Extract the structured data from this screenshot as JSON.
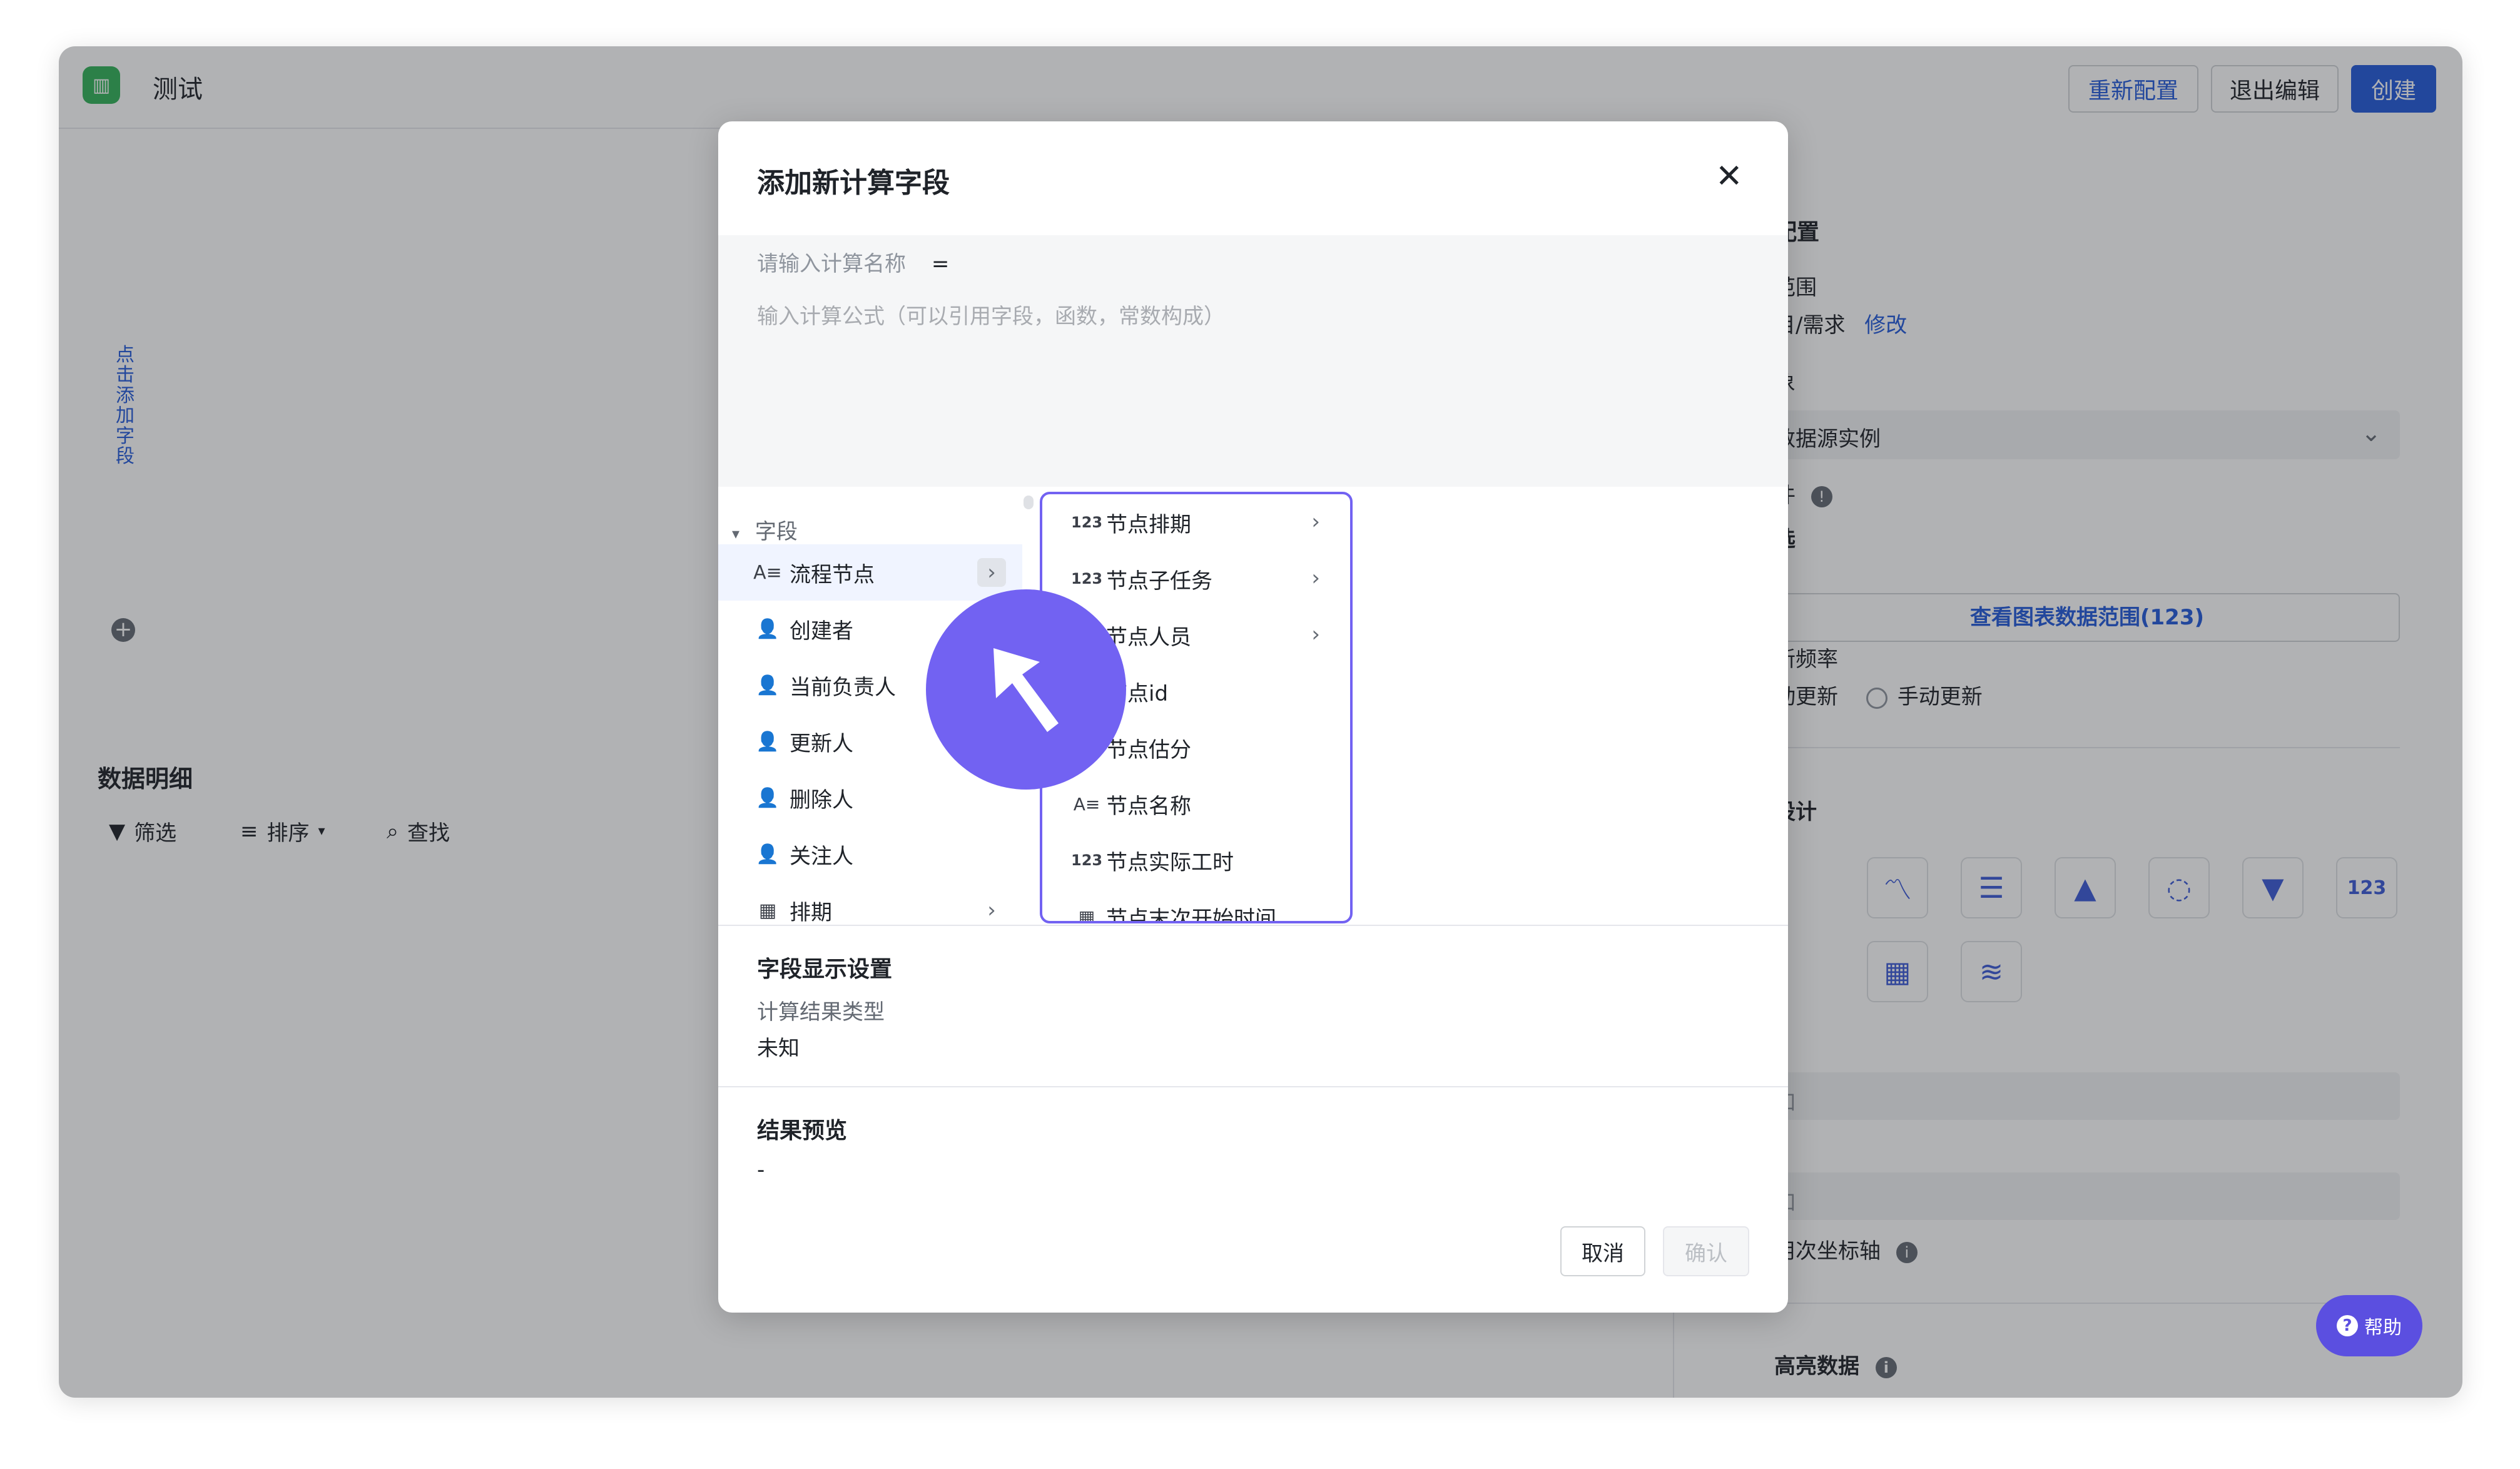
{
  "app": {
    "title": "测试",
    "icon": "bar-chart-icon"
  },
  "header": {
    "reconfigure": "重新配置",
    "exit_edit": "退出编辑",
    "create": "创建"
  },
  "left": {
    "vertical_text": "点击添加字段",
    "detail_title": "数据明细",
    "toolbar": {
      "filter": "筛选",
      "sort": "排序",
      "find": "查找"
    }
  },
  "right": {
    "config_title": "配置",
    "range_label": "范围",
    "range_value": "目/需求",
    "range_edit": "修改",
    "object_label": "象",
    "object_value": "数据源实例",
    "condition_label": "件",
    "condition_value": "选",
    "view_range_btn": "查看图表数据范围(123)",
    "refresh_label": "新频率",
    "refresh_auto": "动更新",
    "refresh_manual": "手动更新",
    "design_label": "设计",
    "input1_ph": "加",
    "input2_ph": "加",
    "secondary_axis": "用次坐标轴",
    "highlight": "高亮数据"
  },
  "help": {
    "label": "帮助"
  },
  "modal": {
    "title": "添加新计算字段",
    "name_placeholder": "请输入计算名称",
    "equals": "=",
    "formula_placeholder": "输入计算公式（可以引用字段，函数，常数构成）",
    "field_header": "字段",
    "fields": [
      {
        "label": "流程节点",
        "icon": "text-field-icon"
      },
      {
        "label": "创建者",
        "icon": "person-icon"
      },
      {
        "label": "当前负责人",
        "icon": "person-icon"
      },
      {
        "label": "更新人",
        "icon": "person-icon"
      },
      {
        "label": "删除人",
        "icon": "person-icon"
      },
      {
        "label": "关注人",
        "icon": "person-icon"
      },
      {
        "label": "排期",
        "icon": "calendar-icon"
      }
    ],
    "sub_fields": [
      {
        "label": "节点排期",
        "icon": "number-icon"
      },
      {
        "label": "节点子任务",
        "icon": "number-icon"
      },
      {
        "label": "节点人员",
        "icon": "number-icon"
      },
      {
        "label": "节点id",
        "icon": "number-icon"
      },
      {
        "label": "节点估分",
        "icon": "number-icon"
      },
      {
        "label": "节点名称",
        "icon": "text-field-icon"
      },
      {
        "label": "节点实际工时",
        "icon": "number-icon"
      },
      {
        "label": "节点末次开始时间",
        "icon": "calendar-icon"
      }
    ],
    "display_settings": "字段显示设置",
    "result_type_label": "计算结果类型",
    "result_type_value": "未知",
    "preview_title": "结果预览",
    "preview_value": "-",
    "cancel": "取消",
    "confirm": "确认"
  },
  "colors": {
    "accent": "#245bdb",
    "cursor": "#7262f2",
    "brand_green": "#34b35a"
  }
}
